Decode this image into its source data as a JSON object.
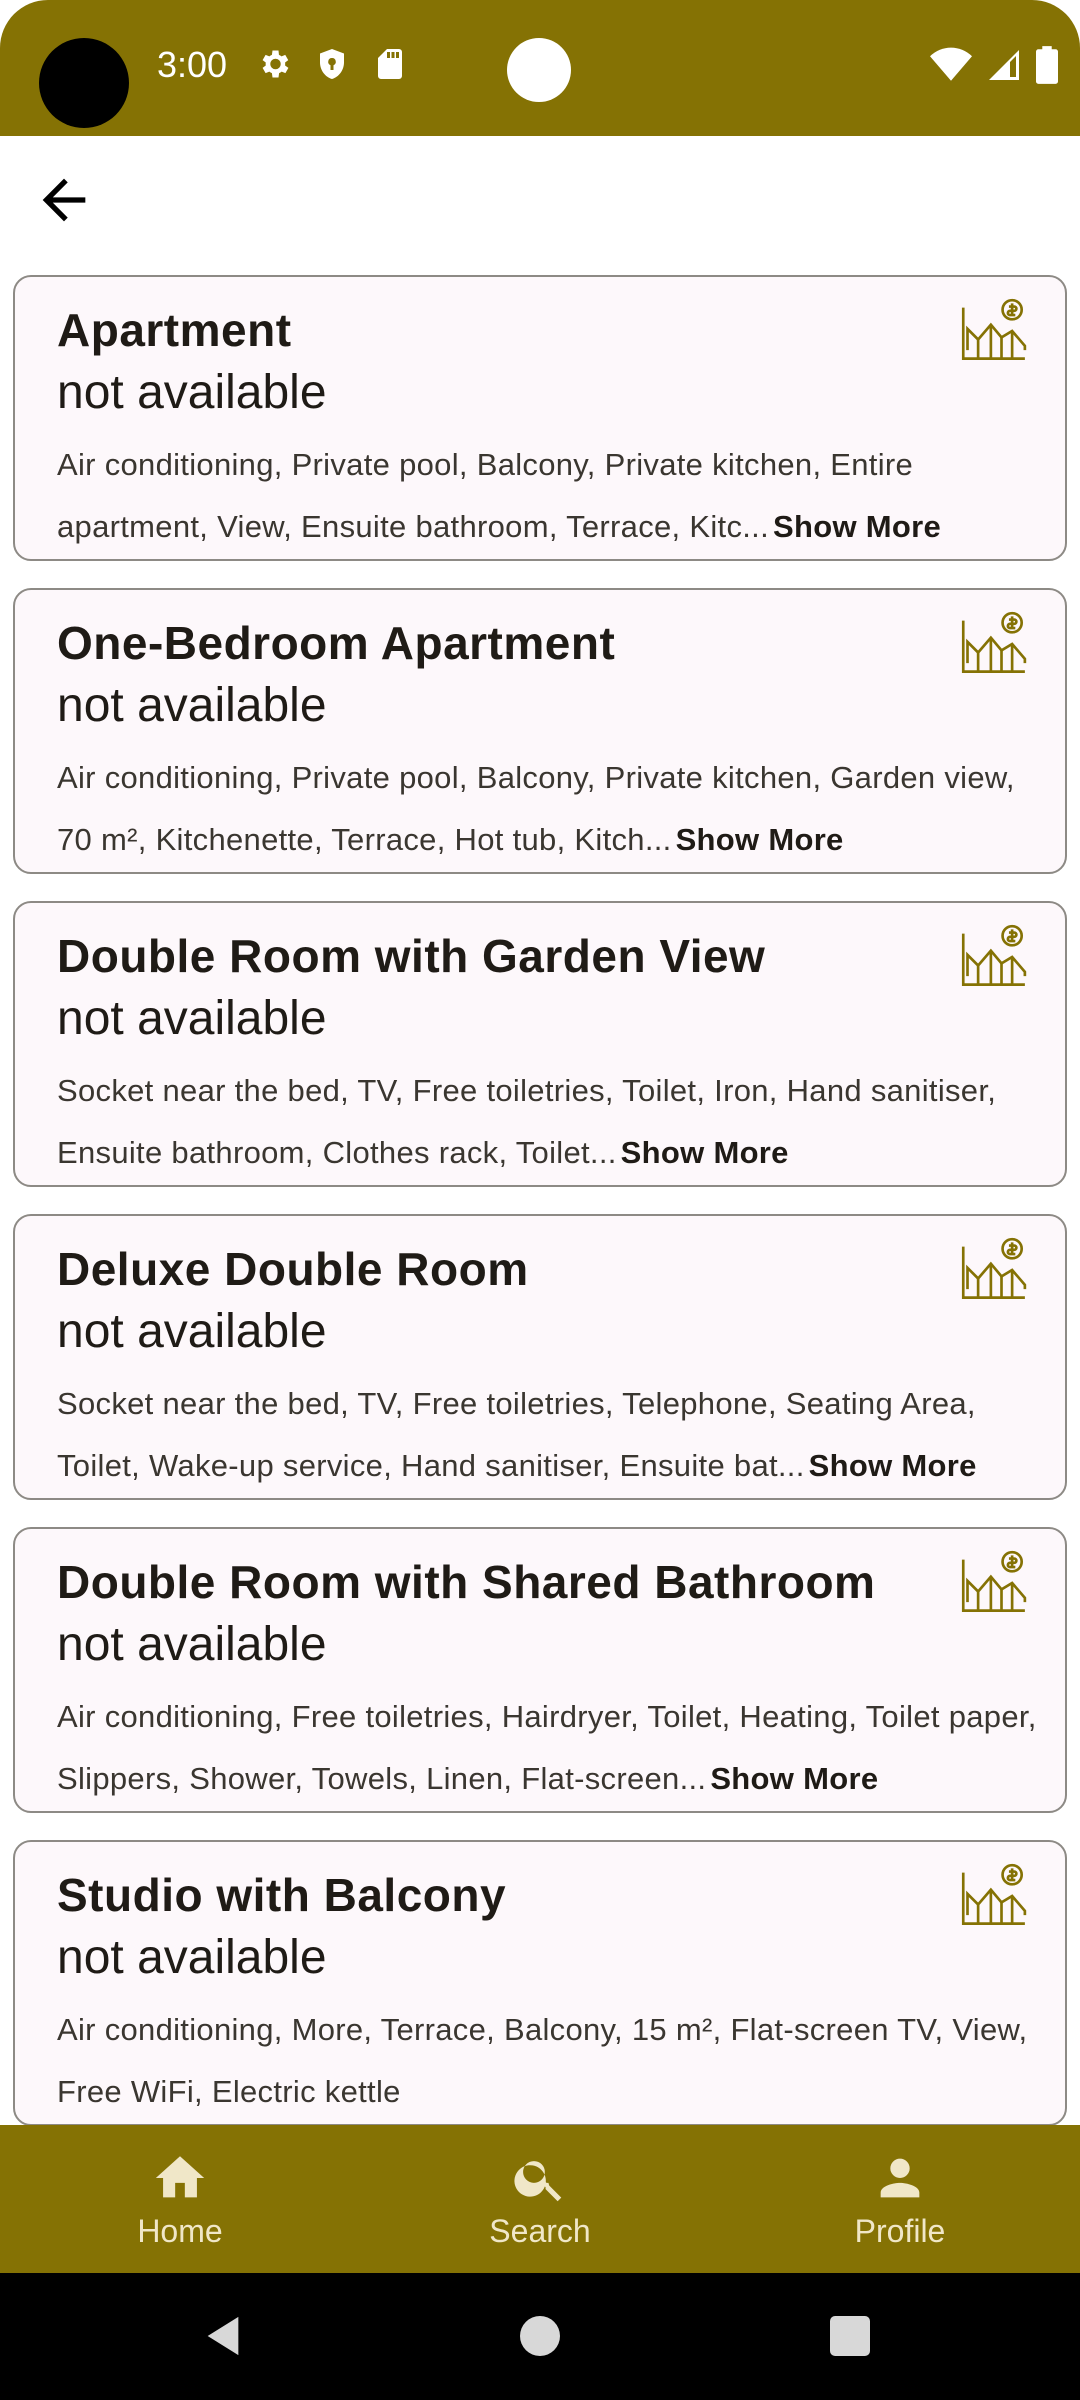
{
  "status_bar": {
    "time": "3:00",
    "left_icons": [
      "gear-icon",
      "shield-icon",
      "sd-card-icon"
    ],
    "right_icons": [
      "wifi-icon",
      "signal-icon",
      "battery-icon"
    ],
    "color": "#857204"
  },
  "top_bar": {
    "back_icon": "arrow-back-icon"
  },
  "rooms": [
    {
      "title": "Apartment",
      "availability": "not available",
      "amenities": "Air conditioning, Private pool, Balcony, Private kitchen, Entire apartment, View, Ensuite bathroom, Terrace, Kitc...",
      "show_more": "Show More"
    },
    {
      "title": "One-Bedroom Apartment",
      "availability": "not available",
      "amenities": "Air conditioning, Private pool, Balcony, Private kitchen, Garden view, 70 m², Kitchenette, Terrace, Hot tub, Kitch...",
      "show_more": "Show More"
    },
    {
      "title": "Double Room with Garden View",
      "availability": "not available",
      "amenities": "Socket near the bed, TV, Free toiletries, Toilet, Iron, Hand sanitiser, Ensuite bathroom, Clothes rack, Toilet...",
      "show_more": "Show More"
    },
    {
      "title": "Deluxe Double Room",
      "availability": "not available",
      "amenities": "Socket near the bed, TV, Free toiletries, Telephone, Seating Area, Toilet, Wake-up service, Hand sanitiser, Ensuite bat...",
      "show_more": "Show More"
    },
    {
      "title": "Double Room with Shared Bathroom",
      "availability": "not available",
      "amenities": "Air conditioning, Free toiletries, Hairdryer, Toilet, Heating, Toilet paper, Slippers, Shower, Towels, Linen, Flat-screen...",
      "show_more": "Show More"
    },
    {
      "title": "Studio with Balcony",
      "availability": "not available",
      "amenities": "Air conditioning, More, Terrace, Balcony, 15 m², Flat-screen TV, View, Free WiFi, Electric kettle",
      "show_more": ""
    }
  ],
  "room_icon": "price-chart-icon",
  "bottom_nav": {
    "items": [
      {
        "label": "Home",
        "icon": "home-icon"
      },
      {
        "label": "Search",
        "icon": "search-icon"
      },
      {
        "label": "Profile",
        "icon": "person-icon"
      }
    ]
  },
  "colors": {
    "accent": "#857204",
    "card_bg": "#fdf8fb",
    "card_border": "#8d8a85"
  }
}
